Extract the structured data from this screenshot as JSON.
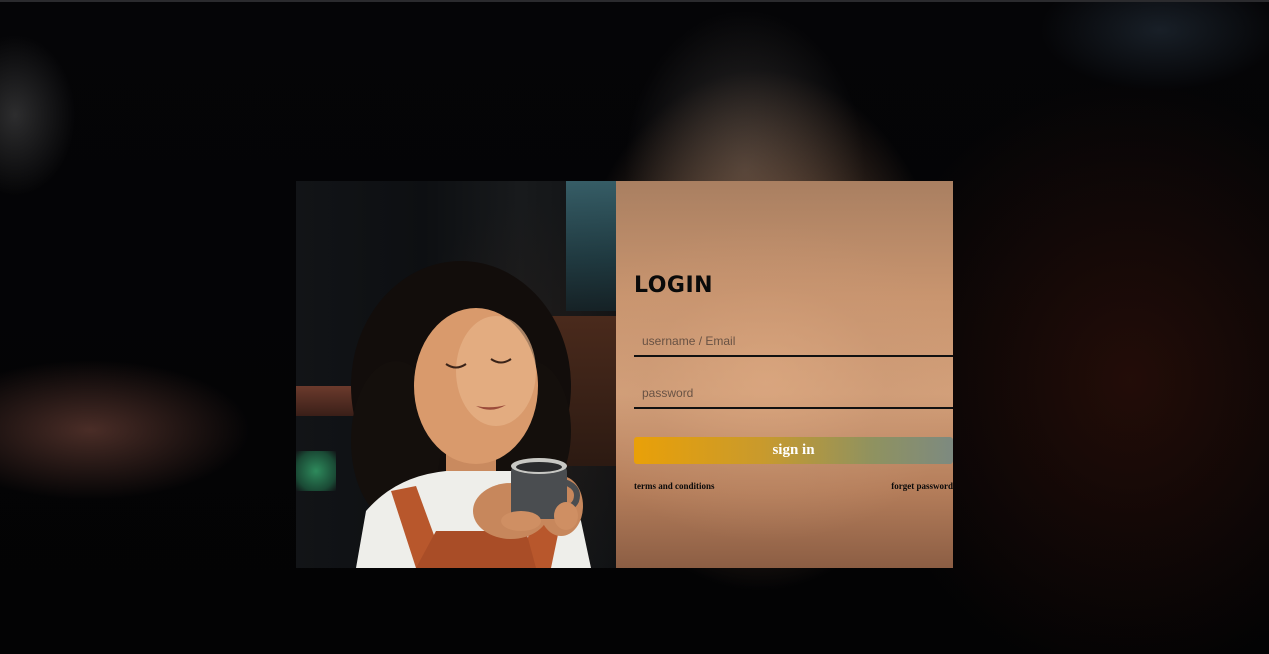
{
  "login": {
    "title": "LOGIN",
    "username_placeholder": "username / Email",
    "password_placeholder": "password",
    "sign_in_label": "sign in",
    "terms_link": "terms and conditions",
    "forgot_link": "forget password"
  },
  "colors": {
    "button_gradient_start": "#e9a008",
    "button_gradient_end": "#7d8a80",
    "field_underline": "#111111"
  }
}
